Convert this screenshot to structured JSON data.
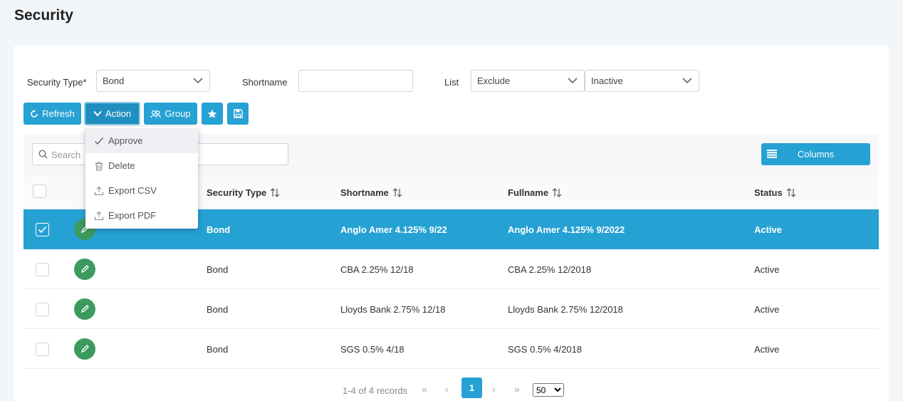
{
  "page": {
    "title": "Security"
  },
  "filters": {
    "security_type_label": "Security Type*",
    "security_type_value": "Bond",
    "shortname_label": "Shortname",
    "shortname_value": "",
    "list_label": "List",
    "list_value": "Exclude",
    "status_value": "Inactive"
  },
  "toolbar": {
    "refresh_label": "Refresh",
    "action_label": "Action",
    "group_label": "Group"
  },
  "action_menu": {
    "items": [
      {
        "label": "Approve",
        "icon": "check-icon"
      },
      {
        "label": "Delete",
        "icon": "trash-icon"
      },
      {
        "label": "Export CSV",
        "icon": "upload-icon"
      },
      {
        "label": "Export PDF",
        "icon": "upload-icon"
      }
    ]
  },
  "grid": {
    "search_placeholder": "Search",
    "columns_button": "Columns",
    "columns": [
      "Security Type",
      "Shortname",
      "Fullname",
      "Status"
    ],
    "rows": [
      {
        "security_type": "Bond",
        "shortname": "Anglo Amer 4.125% 9/22",
        "fullname": "Anglo Amer 4.125% 9/2022",
        "status": "Active",
        "selected": true,
        "partial": "N"
      },
      {
        "security_type": "Bond",
        "shortname": "CBA 2.25% 12/18",
        "fullname": "CBA 2.25% 12/2018",
        "status": "Active",
        "selected": false
      },
      {
        "security_type": "Bond",
        "shortname": "Lloyds Bank 2.75% 12/18",
        "fullname": "Lloyds Bank 2.75% 12/2018",
        "status": "Active",
        "selected": false
      },
      {
        "security_type": "Bond",
        "shortname": "SGS 0.5% 4/18",
        "fullname": "SGS 0.5% 4/2018",
        "status": "Active",
        "selected": false
      }
    ]
  },
  "pager": {
    "info": "1-4 of 4 records",
    "current_page": "1",
    "page_size": "50",
    "first": "«",
    "prev": "‹",
    "next": "›",
    "last": "»"
  },
  "colors": {
    "accent": "#26a1d3",
    "edit_green": "#3c9a5f"
  }
}
